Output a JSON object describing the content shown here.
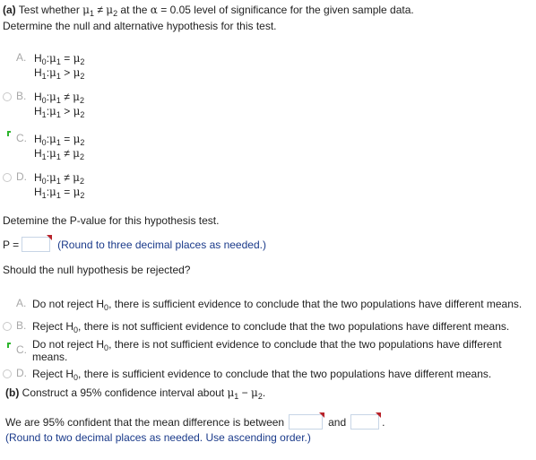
{
  "part_a": {
    "label": "(a)",
    "question_prefix": "Test whether ",
    "mu1": "μ",
    "mu1_sub": "1",
    "neq": " ≠ ",
    "mu2": "μ",
    "mu2_sub": "2",
    "question_mid": " at the ",
    "alpha": "α",
    "question_suffix": " = 0.05 level of significance for the given sample data.",
    "instruction": "Determine the null and alternative hypothesis for this test."
  },
  "hypothesis_options": [
    {
      "letter": "A.",
      "state": "selected-hidden",
      "h0": {
        "label": "H",
        "sub": "0",
        "rel": "="
      },
      "h1": {
        "label": "H",
        "sub": "1",
        "rel": ">"
      }
    },
    {
      "letter": "B.",
      "state": "radio",
      "h0": {
        "label": "H",
        "sub": "0",
        "rel": "≠"
      },
      "h1": {
        "label": "H",
        "sub": "1",
        "rel": ">"
      }
    },
    {
      "letter": "C.",
      "state": "correct",
      "h0": {
        "label": "H",
        "sub": "0",
        "rel": "="
      },
      "h1": {
        "label": "H",
        "sub": "1",
        "rel": "≠"
      }
    },
    {
      "letter": "D.",
      "state": "radio",
      "h0": {
        "label": "H",
        "sub": "0",
        "rel": "≠"
      },
      "h1": {
        "label": "H",
        "sub": "1",
        "rel": "="
      }
    }
  ],
  "pvalue": {
    "prompt": "Detemine the P-value for this hypothesis test.",
    "label": "P =",
    "input_value": "",
    "hint": "(Round to three decimal places as needed.)"
  },
  "reject_question": "Should the null hypothesis be rejected?",
  "decision_options": [
    {
      "letter": "A.",
      "state": "selected-hidden",
      "prefix": "Do not reject H",
      "sub": "0",
      "suffix": ", there is sufficient evidence to conclude that the two populations have different means."
    },
    {
      "letter": "B.",
      "state": "radio",
      "prefix": "Reject H",
      "sub": "0",
      "suffix": ", there is not sufficient evidence to conclude that the two populations have different means."
    },
    {
      "letter": "C.",
      "state": "correct",
      "prefix": "Do not reject H",
      "sub": "0",
      "suffix": ", there is not sufficient evidence to conclude that the two populations have different means."
    },
    {
      "letter": "D.",
      "state": "radio",
      "prefix": "Reject H",
      "sub": "0",
      "suffix": ", there is sufficient evidence to conclude that the two populations have different means."
    }
  ],
  "part_b": {
    "label": "(b)",
    "question": "Construct a 95% confidence interval about ",
    "mu1": "μ",
    "mu1_sub": "1",
    "minus": " − ",
    "mu2": "μ",
    "mu2_sub": "2",
    "period": ".",
    "ci_prefix": "We are 95% confident that the mean difference is between",
    "ci_and": "and",
    "ci_suffix": ".",
    "lower_value": "",
    "upper_value": "",
    "hint": "(Round to two decimal places as needed. Use ascending order.)"
  },
  "colors": {
    "hint_text": "#1a3a8a",
    "correct_mark": "#2db52d",
    "input_flag": "#b8232a",
    "option_letter": "#a8a8a8"
  }
}
